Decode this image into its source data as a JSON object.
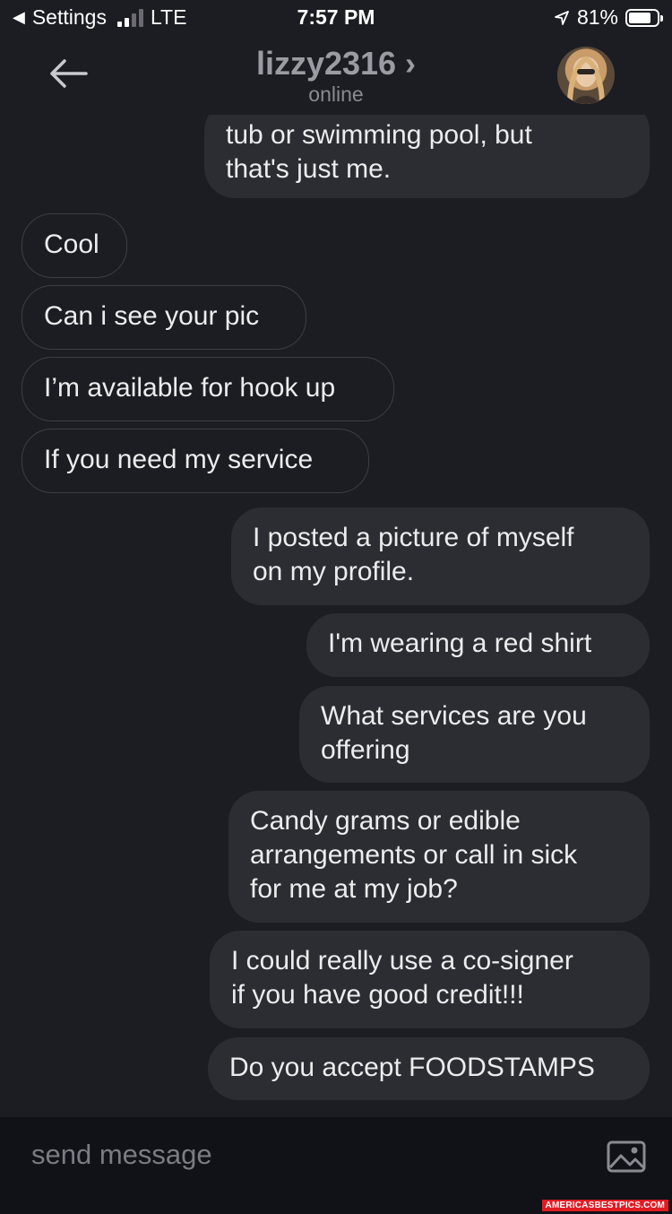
{
  "status_bar": {
    "back_app": "Settings",
    "network": "LTE",
    "time": "7:57 PM",
    "battery": "81%",
    "battery_level": 0.81
  },
  "header": {
    "title": "lizzy2316 ›",
    "subtitle": "online"
  },
  "messages": [
    {
      "side": "out",
      "text": "tub or swimming pool, but\nthat's just me."
    },
    {
      "side": "in",
      "text": "Cool"
    },
    {
      "side": "in",
      "text": "Can i see your pic"
    },
    {
      "side": "in",
      "text": "I’m available for hook up"
    },
    {
      "side": "in",
      "text": "If you need my service"
    },
    {
      "side": "out",
      "text": "I posted a picture of myself\non my profile."
    },
    {
      "side": "out",
      "text": "I'm wearing a red shirt"
    },
    {
      "side": "out",
      "text": "What services are you\noffering"
    },
    {
      "side": "out",
      "text": "Candy grams or edible\narrangements or call in sick\nfor me at my job?"
    },
    {
      "side": "out",
      "text": "I could really use a co-signer\nif you have good credit!!!"
    },
    {
      "side": "out",
      "text": "Do you accept FOODSTAMPS"
    }
  ],
  "composer": {
    "placeholder": "send message",
    "icon": "image-icon"
  },
  "watermark": "AMERICASBESTPICS.COM"
}
